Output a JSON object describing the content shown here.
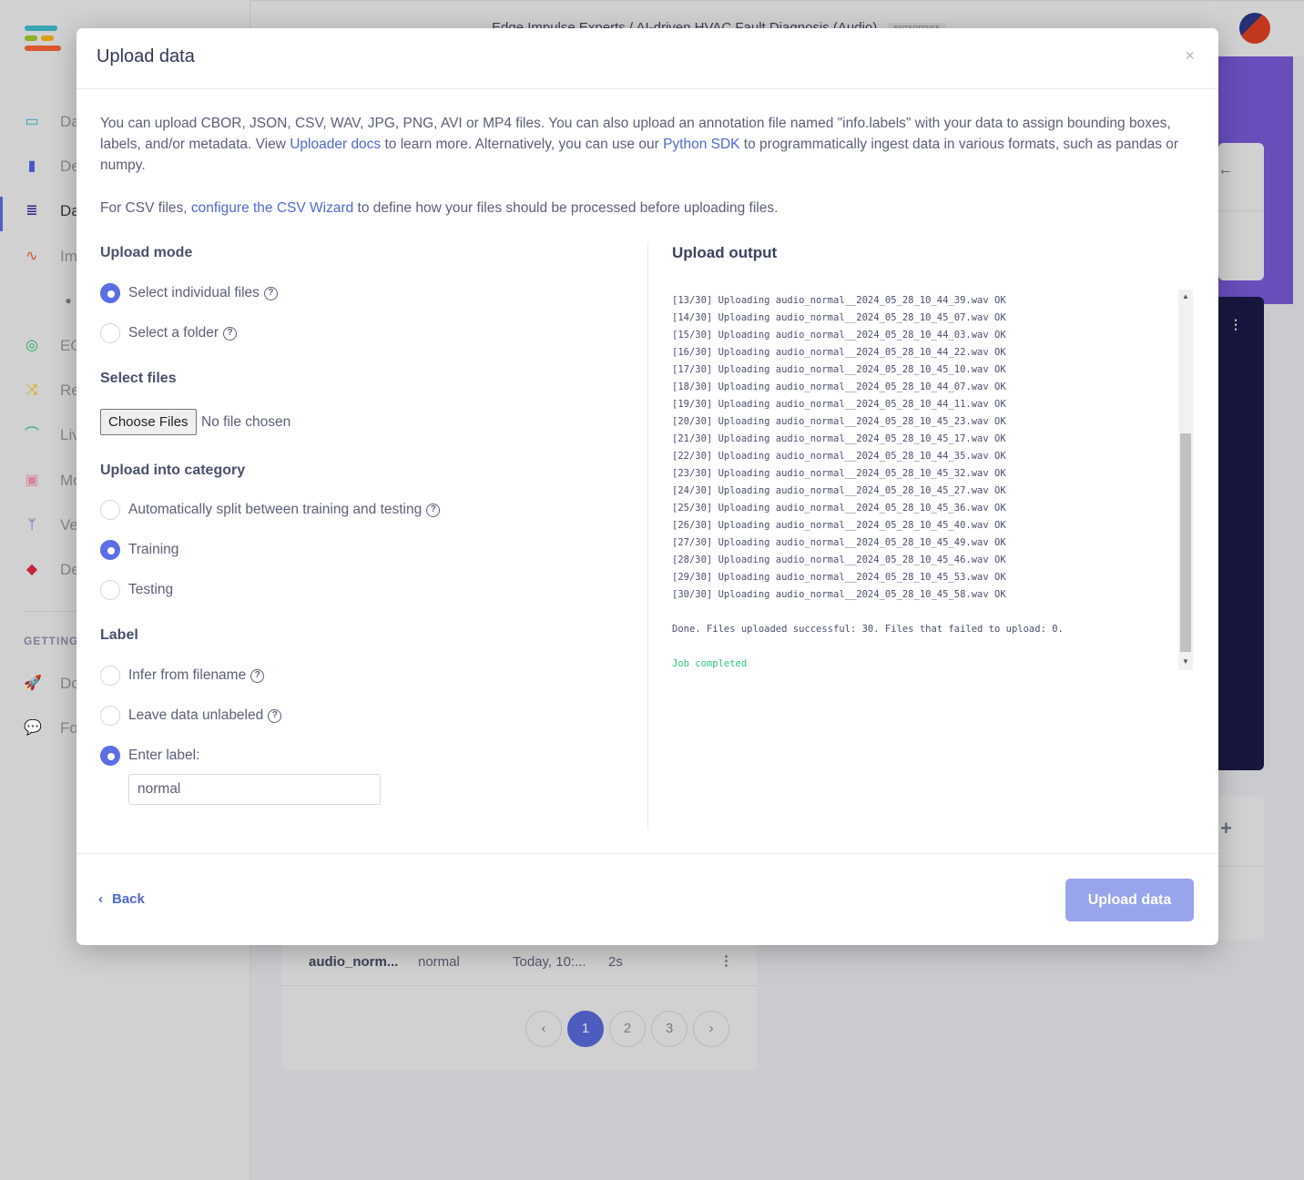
{
  "background": {
    "breadcrumb": {
      "org": "Edge Impulse Experts",
      "sep": "/",
      "project": "AI-driven HVAC Fault Diagnosis (Audio)",
      "badge": "ENTERPRISE"
    },
    "sidebar": {
      "items": [
        {
          "label": "Da",
          "icon": "monitor-icon",
          "color": "#2aa8c4"
        },
        {
          "label": "De",
          "icon": "chip-icon",
          "color": "#4a5ac7"
        },
        {
          "label": "Da",
          "icon": "database-icon",
          "color": "#3b1e8a",
          "active": true
        },
        {
          "label": "Im",
          "icon": "pulse-icon",
          "color": "#d9552f"
        },
        {
          "label": "",
          "icon": "dot-icon",
          "color": "#707887"
        },
        {
          "label": "EO",
          "icon": "compass-icon",
          "color": "#2eac6a"
        },
        {
          "label": "Re",
          "icon": "shuffle-icon",
          "color": "#d8b000"
        },
        {
          "label": "Liv",
          "icon": "bezier-icon",
          "color": "#2eac6a"
        },
        {
          "label": "Mo",
          "icon": "clipboard-check-icon",
          "color": "#d9899a"
        },
        {
          "label": "Ve",
          "icon": "branch-icon",
          "color": "#4a5ac7"
        },
        {
          "label": "De",
          "icon": "cube-icon",
          "color": "#c8243c"
        }
      ],
      "section": "GETTING",
      "extra": [
        {
          "label": "Do",
          "icon": "rocket-icon"
        },
        {
          "label": "Fo",
          "icon": "chat-icon"
        }
      ]
    },
    "table_row": {
      "name": "audio_norm...",
      "label": "normal",
      "added": "Today, 10:...",
      "length": "2s"
    },
    "pagination": {
      "prev": "‹",
      "pages": [
        "1",
        "2",
        "3"
      ],
      "current": "1",
      "next": "›"
    }
  },
  "modal": {
    "title": "Upload data",
    "close": "×",
    "intro": {
      "t1": "You can upload CBOR, JSON, CSV, WAV, JPG, PNG, AVI or MP4 files. You can also upload an annotation file named \"info.labels\" with your data to assign bounding boxes, labels, and/or metadata. View ",
      "link1": "Uploader docs",
      "t2": " to learn more. Alternatively, you can use our ",
      "link2": "Python SDK",
      "t3": " to programmatically ingest data in various formats, such as pandas or numpy."
    },
    "csv": {
      "t1": "For CSV files, ",
      "link": "configure the CSV Wizard",
      "t2": " to define how your files should be processed before uploading files."
    },
    "upload_mode": {
      "heading": "Upload mode",
      "options": [
        "Select individual files",
        "Select a folder"
      ],
      "selected": "Select individual files"
    },
    "select_files": {
      "heading": "Select files",
      "button": "Choose Files",
      "status": "No file chosen"
    },
    "category": {
      "heading": "Upload into category",
      "options": [
        "Automatically split between training and testing",
        "Training",
        "Testing"
      ],
      "selected": "Training"
    },
    "label": {
      "heading": "Label",
      "options": [
        "Infer from filename",
        "Leave data unlabeled",
        "Enter label:"
      ],
      "selected": "Enter label:",
      "value": "normal"
    },
    "output": {
      "heading": "Upload output",
      "lines": [
        "[13/30] Uploading audio_normal__2024_05_28_10_44_39.wav OK",
        "[14/30] Uploading audio_normal__2024_05_28_10_45_07.wav OK",
        "[15/30] Uploading audio_normal__2024_05_28_10_44_03.wav OK",
        "[16/30] Uploading audio_normal__2024_05_28_10_44_22.wav OK",
        "[17/30] Uploading audio_normal__2024_05_28_10_45_10.wav OK",
        "[18/30] Uploading audio_normal__2024_05_28_10_44_07.wav OK",
        "[19/30] Uploading audio_normal__2024_05_28_10_44_11.wav OK",
        "[20/30] Uploading audio_normal__2024_05_28_10_45_23.wav OK",
        "[21/30] Uploading audio_normal__2024_05_28_10_45_17.wav OK",
        "[22/30] Uploading audio_normal__2024_05_28_10_44_35.wav OK",
        "[23/30] Uploading audio_normal__2024_05_28_10_45_32.wav OK",
        "[24/30] Uploading audio_normal__2024_05_28_10_45_27.wav OK",
        "[25/30] Uploading audio_normal__2024_05_28_10_45_36.wav OK",
        "[26/30] Uploading audio_normal__2024_05_28_10_45_40.wav OK",
        "[27/30] Uploading audio_normal__2024_05_28_10_45_49.wav OK",
        "[28/30] Uploading audio_normal__2024_05_28_10_45_46.wav OK",
        "[29/30] Uploading audio_normal__2024_05_28_10_45_53.wav OK",
        "[30/30] Uploading audio_normal__2024_05_28_10_45_58.wav OK"
      ],
      "summary": "Done. Files uploaded successful: 30. Files that failed to upload: 0.",
      "status": "Job completed",
      "status_color": "#2fc37a"
    },
    "footer": {
      "back": "Back",
      "submit": "Upload data"
    }
  }
}
